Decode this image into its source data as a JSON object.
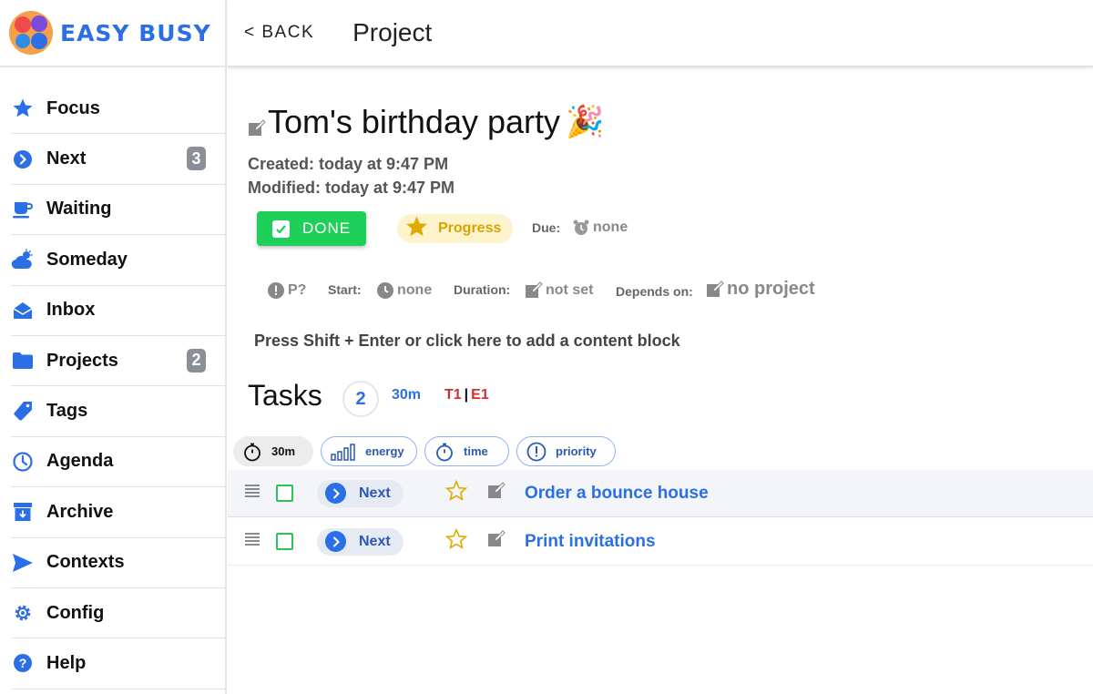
{
  "app": {
    "brand": "EASY BUSY"
  },
  "header": {
    "back_label": "< BACK",
    "title": "Project"
  },
  "sidebar": {
    "items": [
      {
        "label": "Focus",
        "icon": "star-icon",
        "badge": ""
      },
      {
        "label": "Next",
        "icon": "chevron-circle-icon",
        "badge": "3"
      },
      {
        "label": "Waiting",
        "icon": "coffee-cup-icon",
        "badge": ""
      },
      {
        "label": "Someday",
        "icon": "cloud-sun-icon",
        "badge": ""
      },
      {
        "label": "Inbox",
        "icon": "envelope-open-icon",
        "badge": ""
      },
      {
        "label": "Projects",
        "icon": "folder-icon",
        "badge": "2"
      },
      {
        "label": "Tags",
        "icon": "tag-icon",
        "badge": ""
      },
      {
        "label": "Agenda",
        "icon": "clock-icon",
        "badge": ""
      },
      {
        "label": "Archive",
        "icon": "archive-box-icon",
        "badge": ""
      },
      {
        "label": "Contexts",
        "icon": "paper-plane-icon",
        "badge": ""
      },
      {
        "label": "Config",
        "icon": "gear-icon",
        "badge": ""
      },
      {
        "label": "Help",
        "icon": "question-circle-icon",
        "badge": ""
      }
    ]
  },
  "project": {
    "title": "Tom's birthday party",
    "emoji": "🎉",
    "created": "Created: today at 9:47 PM",
    "modified": "Modified: today at 9:47 PM",
    "done_label": "DONE",
    "status_label": "Progress",
    "due_label": "Due:",
    "due_value": "none",
    "priority_value": "P?",
    "start_label": "Start:",
    "start_value": "none",
    "duration_label": "Duration:",
    "duration_value": "not set",
    "depends_label": "Depends on:",
    "depends_value": "no project",
    "add_block_hint": "Press Shift + Enter or click here to add a content block"
  },
  "tasks": {
    "heading": "Tasks",
    "count": "2",
    "total_time": "30m",
    "t_label": "T1",
    "sep": "|",
    "e_label": "E1",
    "filters": [
      {
        "label": "30m",
        "icon": "stopwatch-icon",
        "selected": true
      },
      {
        "label": "energy",
        "icon": "signal-bars-icon",
        "selected": false
      },
      {
        "label": "time",
        "icon": "stopwatch-icon",
        "selected": false
      },
      {
        "label": "priority",
        "icon": "exclamation-circle-icon",
        "selected": false
      }
    ],
    "items": [
      {
        "status": "Next",
        "name": "Order a bounce house"
      },
      {
        "status": "Next",
        "name": "Print invitations"
      }
    ]
  },
  "colors": {
    "accent": "#2b6fe6",
    "done_green": "#1ed05a",
    "progress_yellow": "#d8a400",
    "badge_gray": "#8a8f98",
    "alert_red": "#d42d2d"
  }
}
